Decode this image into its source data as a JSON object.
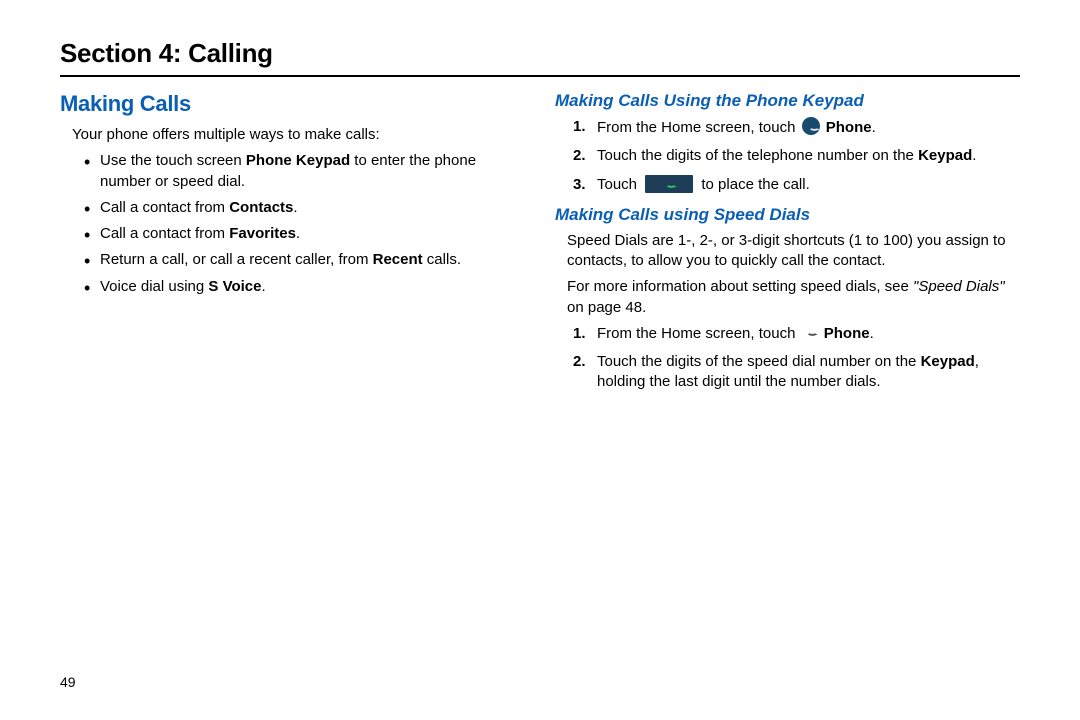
{
  "section_title": "Section 4: Calling",
  "page_number": "49",
  "left": {
    "heading": "Making Calls",
    "intro": "Your phone offers multiple ways to make calls:",
    "bullets": {
      "b1a": "Use the touch screen ",
      "b1b": "Phone Keypad",
      "b1c": " to enter the phone number or speed dial.",
      "b2a": "Call a contact from ",
      "b2b": "Contacts",
      "b2c": ".",
      "b3a": "Call a contact from ",
      "b3b": "Favorites",
      "b3c": ".",
      "b4a": "Return a call, or call a recent caller, from ",
      "b4b": "Recent",
      "b4c": " calls.",
      "b5a": "Voice dial using ",
      "b5b": "S Voice",
      "b5c": "."
    }
  },
  "right": {
    "h3a": "Making Calls Using the Phone Keypad",
    "steps_a": {
      "n1": "1.",
      "s1a": "From the Home screen, touch ",
      "s1b": "Phone",
      "s1c": ".",
      "n2": "2.",
      "s2a": "Touch the digits of the telephone number on the ",
      "s2b": "Keypad",
      "s2c": ".",
      "n3": "3.",
      "s3a": "Touch ",
      "s3b": " to place the call."
    },
    "h3b": "Making Calls using Speed Dials",
    "para1": "Speed Dials are 1-, 2-, or 3-digit shortcuts (1 to 100) you assign to contacts, to allow you to quickly call the contact.",
    "para2a": "For more information about setting speed dials, see ",
    "para2b": "\"Speed Dials\"",
    "para2c": " on page 48.",
    "steps_b": {
      "n1": "1.",
      "s1a": "From the Home screen, touch ",
      "s1b": "Phone",
      "s1c": ".",
      "n2": "2.",
      "s2a": "Touch the digits of the speed dial number on the ",
      "s2b": "Keypad",
      "s2c": ", holding the last digit until the number dials."
    }
  }
}
